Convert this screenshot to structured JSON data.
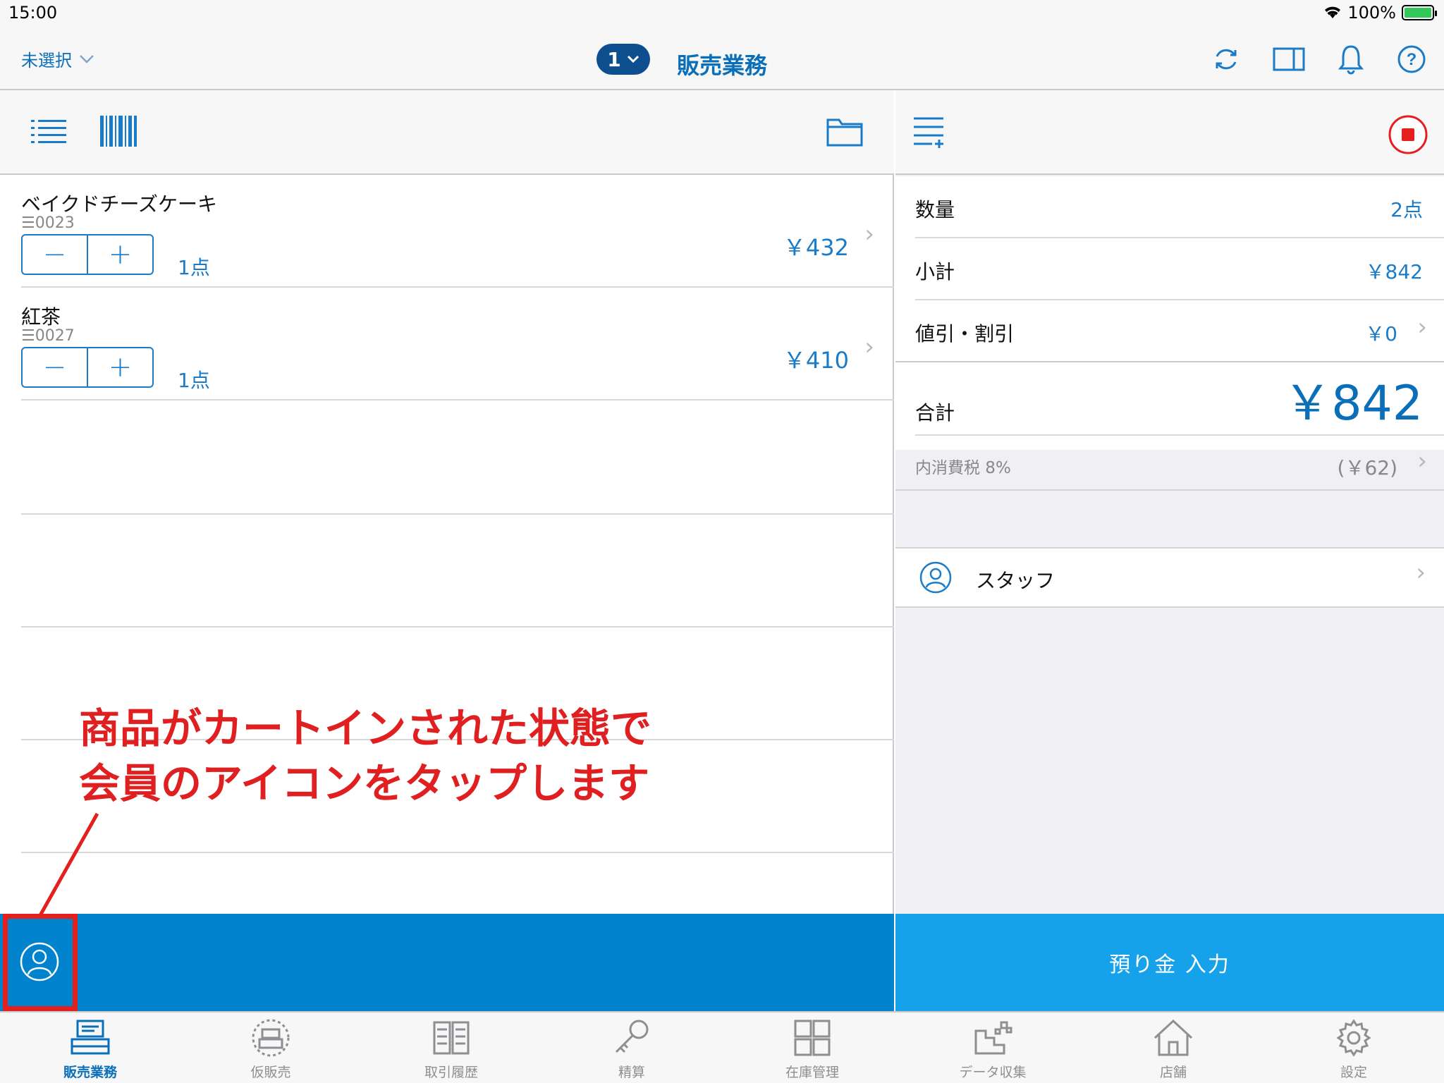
{
  "status": {
    "time": "15:00",
    "battery": "100%"
  },
  "nav": {
    "store_select": "未選択",
    "register_no": "1",
    "title": "販売業務"
  },
  "cart": {
    "items": [
      {
        "name": "ベイクドチーズケーキ",
        "code": "0023",
        "qty": "1点",
        "price": "￥432"
      },
      {
        "name": "紅茶",
        "code": "0027",
        "qty": "1点",
        "price": "￥410"
      }
    ]
  },
  "annotation": {
    "line1": "商品がカートインされた状態で",
    "line2": "会員のアイコンをタップします"
  },
  "summary": {
    "quantity_label": "数量",
    "quantity_value": "2点",
    "subtotal_label": "小計",
    "subtotal_value": "￥842",
    "discount_label": "値引・割引",
    "discount_value": "￥0",
    "total_label": "合計",
    "total_value": "￥842",
    "tax_label": "内消費税 8%",
    "tax_value": "(￥62)",
    "staff_label": "スタッフ"
  },
  "pay_button": "預り金 入力",
  "tabs": [
    {
      "label": "販売業務",
      "icon": "register-icon"
    },
    {
      "label": "仮販売",
      "icon": "temp-sale-icon"
    },
    {
      "label": "取引履歴",
      "icon": "history-icon"
    },
    {
      "label": "精算",
      "icon": "key-icon"
    },
    {
      "label": "在庫管理",
      "icon": "inventory-icon"
    },
    {
      "label": "データ収集",
      "icon": "data-icon"
    },
    {
      "label": "店舗",
      "icon": "store-icon"
    },
    {
      "label": "設定",
      "icon": "gear-icon"
    }
  ],
  "colors": {
    "accent": "#0a6fb8",
    "bottom_bar": "#0082cc",
    "pay": "#16a2ea",
    "annotation": "#e02020"
  }
}
